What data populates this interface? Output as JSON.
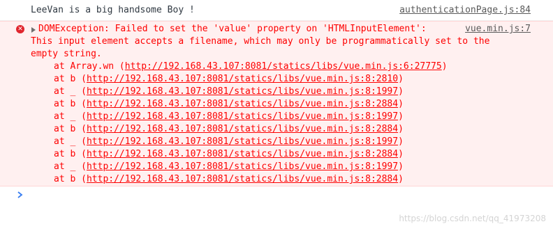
{
  "log": {
    "message": "LeeVan is a big handsome Boy !",
    "source": "authenticationPage.js:84"
  },
  "error": {
    "icon": "error-icon",
    "headline": "DOMException: Failed to set the 'value' property on 'HTMLInputElement':",
    "source": "vue.min.js:7",
    "detail_line_1": "This input element accepts a filename, which may only be programmatically set to the",
    "detail_line_2": "empty string.",
    "stack": [
      {
        "prefix": "at Array.wn (",
        "url": "http://192.168.43.107:8081/statics/libs/vue.min.js:6:27775",
        "suffix": ")"
      },
      {
        "prefix": "at b (",
        "url": "http://192.168.43.107:8081/statics/libs/vue.min.js:8:2810",
        "suffix": ")"
      },
      {
        "prefix": "at _ (",
        "url": "http://192.168.43.107:8081/statics/libs/vue.min.js:8:1997",
        "suffix": ")"
      },
      {
        "prefix": "at b (",
        "url": "http://192.168.43.107:8081/statics/libs/vue.min.js:8:2884",
        "suffix": ")"
      },
      {
        "prefix": "at _ (",
        "url": "http://192.168.43.107:8081/statics/libs/vue.min.js:8:1997",
        "suffix": ")"
      },
      {
        "prefix": "at b (",
        "url": "http://192.168.43.107:8081/statics/libs/vue.min.js:8:2884",
        "suffix": ")"
      },
      {
        "prefix": "at _ (",
        "url": "http://192.168.43.107:8081/statics/libs/vue.min.js:8:1997",
        "suffix": ")"
      },
      {
        "prefix": "at b (",
        "url": "http://192.168.43.107:8081/statics/libs/vue.min.js:8:2884",
        "suffix": ")"
      },
      {
        "prefix": "at _ (",
        "url": "http://192.168.43.107:8081/statics/libs/vue.min.js:8:1997",
        "suffix": ")"
      },
      {
        "prefix": "at b (",
        "url": "http://192.168.43.107:8081/statics/libs/vue.min.js:8:2884",
        "suffix": ")"
      }
    ]
  },
  "prompt": {
    "icon": "chevron-right-icon",
    "value": ""
  },
  "watermark": "https://blog.csdn.net/qq_41973208",
  "colors": {
    "error_text": "#fe0000",
    "error_background": "#fff0f0",
    "prompt_chevron": "#367cf1"
  }
}
